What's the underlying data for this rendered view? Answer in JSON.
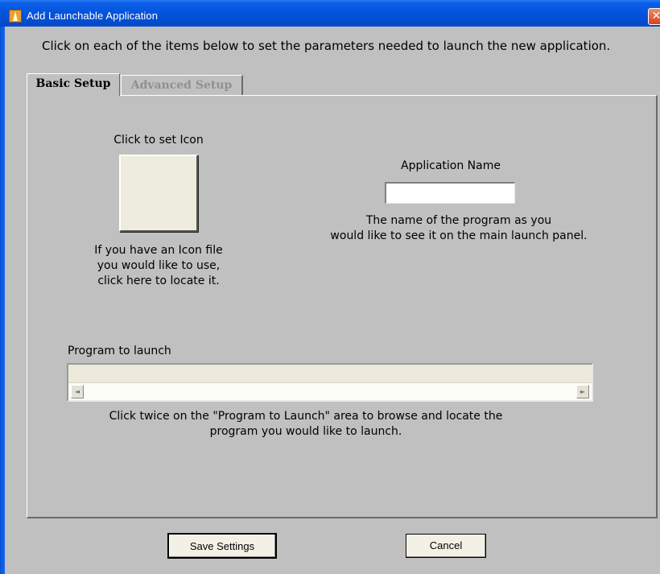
{
  "window": {
    "title": "Add Launchable Application",
    "close_glyph": "✕",
    "app_icon": "launcher-icon"
  },
  "instructions": "Click on each of the items below to set the parameters needed to launch the new application.",
  "tabs": [
    {
      "label": "Basic Setup",
      "active": true
    },
    {
      "label": "Advanced Setup",
      "active": false
    }
  ],
  "icon_section": {
    "label": "Click to set Icon",
    "help_lines": [
      "If you have an Icon file",
      "you would like to use,",
      "click here to locate it."
    ]
  },
  "app_name": {
    "label": "Application Name",
    "value": "",
    "help_lines": [
      "The name of the program as you",
      "would like to see it on the main launch panel."
    ]
  },
  "program": {
    "label": "Program to launch",
    "value": "",
    "scroll_left_glyph": "◄",
    "scroll_right_glyph": "►",
    "help_lines": [
      "Click twice on the \"Program to Launch\" area to browse and locate the",
      "program you would like to launch."
    ]
  },
  "buttons": {
    "save": "Save Settings",
    "cancel": "Cancel"
  },
  "colors": {
    "titlebar": "#0453dc",
    "face": "#c0c0c0",
    "close": "#d9401c"
  }
}
